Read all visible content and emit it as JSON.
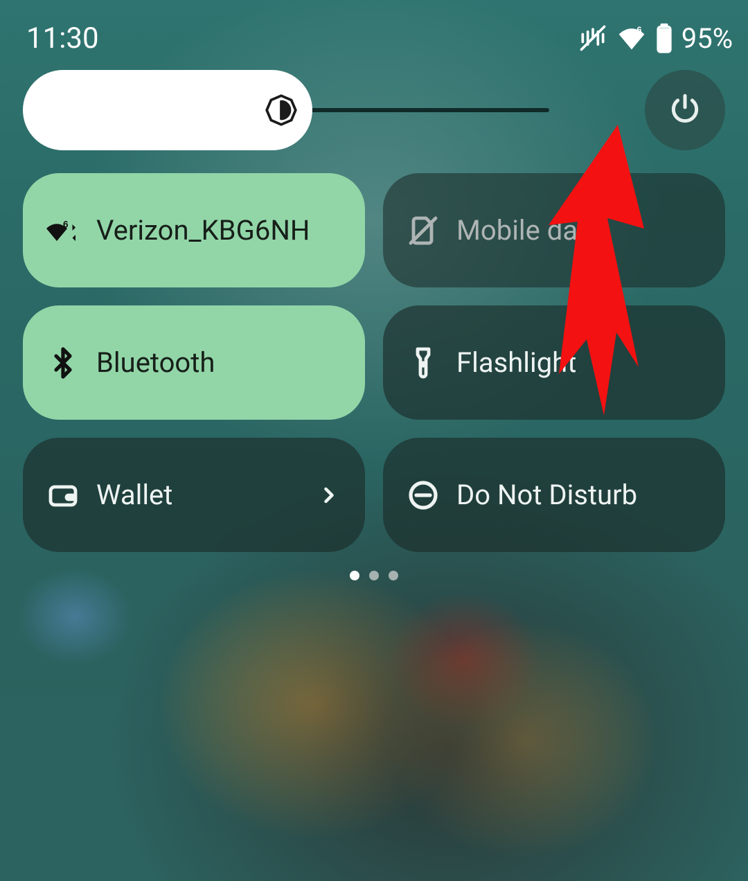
{
  "status": {
    "time": "11:30",
    "battery_text": "95%"
  },
  "brightness": {
    "value_pct": 55,
    "icon_name": "auto-brightness-icon",
    "power_icon_name": "power-icon"
  },
  "tiles": {
    "wifi": {
      "label": "Verizon_KBG6NH",
      "state": "on",
      "icon_name": "wifi6-icon"
    },
    "mobiledata": {
      "label": "Mobile data",
      "state": "off",
      "icon_name": "sim-off-icon"
    },
    "bluetooth": {
      "label": "Bluetooth",
      "state": "on",
      "icon_name": "bluetooth-icon"
    },
    "flashlight": {
      "label": "Flashlight",
      "state": "off",
      "icon_name": "flashlight-icon"
    },
    "wallet": {
      "label": "Wallet",
      "state": "off",
      "icon_name": "wallet-icon",
      "has_chevron": true
    },
    "dnd": {
      "label": "Do Not Disturb",
      "state": "off",
      "icon_name": "dnd-icon"
    }
  },
  "pager": {
    "pages": 3,
    "active": 0
  },
  "annotation": {
    "type": "arrow",
    "target": "power-button",
    "color": "#f31111"
  }
}
